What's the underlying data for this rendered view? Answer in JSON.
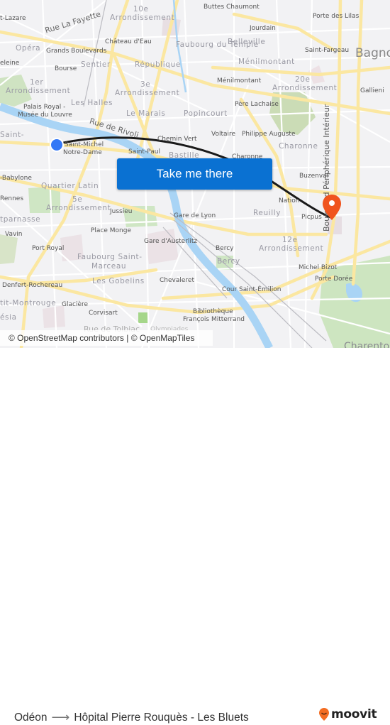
{
  "map": {
    "labels": {
      "saint_lazare": "t-Lazare",
      "rue_la_fayette": "Rue La Fayette",
      "arr10_num": "10e",
      "arr10_word": "Arrondissement",
      "buttes_chaumont": "Buttes Chaumont",
      "porte_des_lilas": "Porte des Lilas",
      "jourdain": "Jourdain",
      "chateau_deau": "Château d'Eau",
      "faubourg_du_temple": "Faubourg du Temple",
      "belleville": "Belleville",
      "saint_fargeau": "Saint-Fargeau",
      "bagnolet": "Bagnol",
      "opera": "Opéra",
      "grands_boulevards": "Grands Boulevards",
      "menilmontant_district": "Ménilmontant",
      "madeleine": "eleine",
      "bourse": "Bourse",
      "sentier": "Sentier",
      "republique": "République",
      "menilmontant_station": "Ménilmontant",
      "arr20_num": "20e",
      "arr20_word": "Arrondissement",
      "gallieni": "Gallieni",
      "arr1_num": "1er",
      "arr1_word": "Arrondissement",
      "arr3_num": "3e",
      "arr3_word": "Arrondissement",
      "palais_royal": "Palais Royal -",
      "musee_louvre": "Musée du Louvre",
      "les_halles": "Les Halles",
      "le_marais": "Le Marais",
      "popincourt": "Popincourt",
      "pere_lachaise": "Père Lachaise",
      "saint_germain": "Saint-",
      "rue_de_rivoli": "Rue de Rivoli",
      "chemin_vert": "Chemin Vert",
      "voltaire": "Voltaire",
      "philippe_auguste": "Philippe Auguste",
      "charonne_district": "Charonne",
      "boulevard_peripherique": "Boulevard Périphérique Intérieur",
      "saint_paul": "Saint-Paul",
      "bastille": "Bastille",
      "charonne_station": "Charonne",
      "saint_michel": "Saint-Michel",
      "notre_dame": "Notre-Dame",
      "babylone": "-Babylone",
      "buzenval": "Buzenval",
      "quartier_latin": "Quartier Latin",
      "rennes": "Rennes",
      "arr5_num": "5e",
      "arr5_word": "Arrondissement",
      "jussieu": "Jussieu",
      "gare_de_lyon": "Gare de Lyon",
      "nation": "Nation",
      "reuilly": "Reuilly",
      "picpus": "Picpus",
      "montparnasse": "tparnasse",
      "vavin": "Vavin",
      "place_monge": "Place Monge",
      "gare_austerlitz": "Gare d'Austerlitz",
      "port_royal": "Port Royal",
      "arr12_num": "12e",
      "arr12_word": "Arrondissement",
      "faubourg_saint_marceau_1": "Faubourg Saint-",
      "faubourg_saint_marceau_2": "Marceau",
      "bercy_station": "Bercy",
      "bercy_district": "Bercy",
      "michel_bizot": "Michel Bizot",
      "denfert": "Denfert-Rochereau",
      "les_gobelins": "Les Gobelins",
      "chevaleret": "Chevaleret",
      "porte_doree": "Porte Dorée",
      "cour_saint_emilion": "Cour Saint-Émilion",
      "petit_montrouge": "tit-Montrouge",
      "glaciere": "Glacière",
      "alesia": "ésia",
      "corvisart": "Corvisart",
      "bibliotheque": "Bibliothèque",
      "francois_mitterrand": "François Mitterrand",
      "rue_de_tolbiac": "Rue de Tolbiac",
      "olympiades": "Olympiades",
      "charenton": "Charento"
    },
    "origin_marker_color": "#3478f6",
    "destination_marker_color": "#f0541e",
    "route_color": "#1a1a1a",
    "cta_label": "Take me there",
    "cta_color": "#0a71d2",
    "attribution": "© OpenStreetMap contributors | © OpenMapTiles"
  },
  "footer": {
    "origin": "Odéon",
    "arrow": "⟶",
    "destination": "Hôpital Pierre Rouquès - Les Bluets",
    "brand": "moovit",
    "brand_color": "#f36c21"
  }
}
